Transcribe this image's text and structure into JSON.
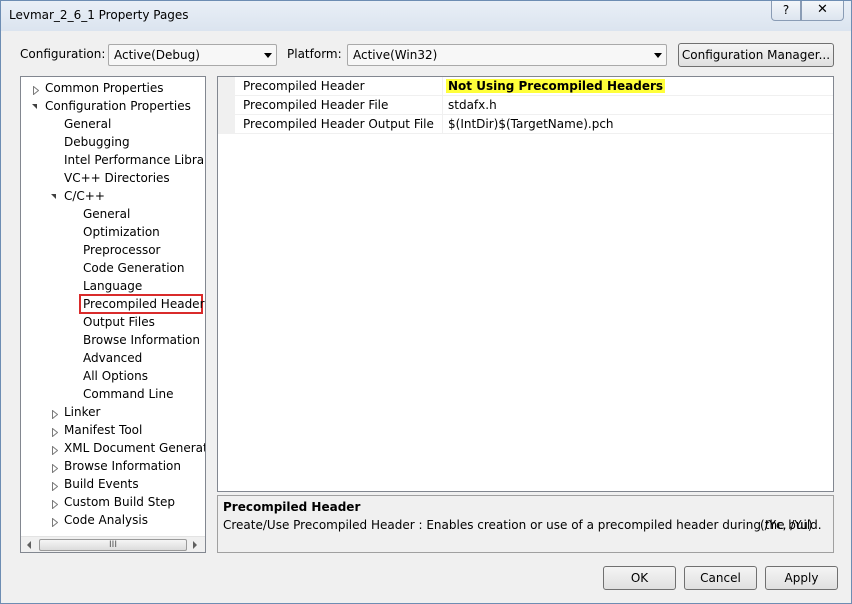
{
  "window": {
    "title": "Levmar_2_6_1 Property Pages",
    "help_glyph": "?",
    "close_glyph": "✕"
  },
  "toolbar": {
    "configuration_label": "Configuration:",
    "configuration_value": "Active(Debug)",
    "platform_label": "Platform:",
    "platform_value": "Active(Win32)",
    "config_manager_label": "Configuration Manager..."
  },
  "tree": {
    "nodes": [
      {
        "label": "Common Properties",
        "level": 0,
        "expander": "collapsed"
      },
      {
        "label": "Configuration Properties",
        "level": 0,
        "expander": "expanded"
      },
      {
        "label": "General",
        "level": 1,
        "expander": "none"
      },
      {
        "label": "Debugging",
        "level": 1,
        "expander": "none"
      },
      {
        "label": "Intel Performance Libraries",
        "level": 1,
        "expander": "none"
      },
      {
        "label": "VC++ Directories",
        "level": 1,
        "expander": "none"
      },
      {
        "label": "C/C++",
        "level": 1,
        "expander": "expanded"
      },
      {
        "label": "General",
        "level": 2,
        "expander": "none"
      },
      {
        "label": "Optimization",
        "level": 2,
        "expander": "none"
      },
      {
        "label": "Preprocessor",
        "level": 2,
        "expander": "none"
      },
      {
        "label": "Code Generation",
        "level": 2,
        "expander": "none"
      },
      {
        "label": "Language",
        "level": 2,
        "expander": "none"
      },
      {
        "label": "Precompiled Headers",
        "level": 2,
        "expander": "none",
        "selected": true
      },
      {
        "label": "Output Files",
        "level": 2,
        "expander": "none"
      },
      {
        "label": "Browse Information",
        "level": 2,
        "expander": "none"
      },
      {
        "label": "Advanced",
        "level": 2,
        "expander": "none"
      },
      {
        "label": "All Options",
        "level": 2,
        "expander": "none"
      },
      {
        "label": "Command Line",
        "level": 2,
        "expander": "none"
      },
      {
        "label": "Linker",
        "level": 1,
        "expander": "collapsed"
      },
      {
        "label": "Manifest Tool",
        "level": 1,
        "expander": "collapsed"
      },
      {
        "label": "XML Document Generator",
        "level": 1,
        "expander": "collapsed"
      },
      {
        "label": "Browse Information",
        "level": 1,
        "expander": "collapsed"
      },
      {
        "label": "Build Events",
        "level": 1,
        "expander": "collapsed"
      },
      {
        "label": "Custom Build Step",
        "level": 1,
        "expander": "collapsed"
      },
      {
        "label": "Code Analysis",
        "level": 1,
        "expander": "collapsed"
      }
    ],
    "scroll_thumb_grip": "III"
  },
  "properties": {
    "rows": [
      {
        "name": "Precompiled Header",
        "value": "Not Using Precompiled Headers",
        "highlight": true
      },
      {
        "name": "Precompiled Header File",
        "value": "stdafx.h",
        "highlight": false
      },
      {
        "name": "Precompiled Header Output File",
        "value": "$(IntDir)$(TargetName).pch",
        "highlight": false
      }
    ]
  },
  "description": {
    "title": "Precompiled Header",
    "text": "Create/Use Precompiled Header : Enables creation or use of a precompiled header during the build.",
    "flags": "(/Yc, /Yu)"
  },
  "buttons": {
    "ok": "OK",
    "cancel": "Cancel",
    "apply": "Apply"
  },
  "colors": {
    "highlight": "#ffff3a",
    "selection_outline": "#d92b2b"
  }
}
